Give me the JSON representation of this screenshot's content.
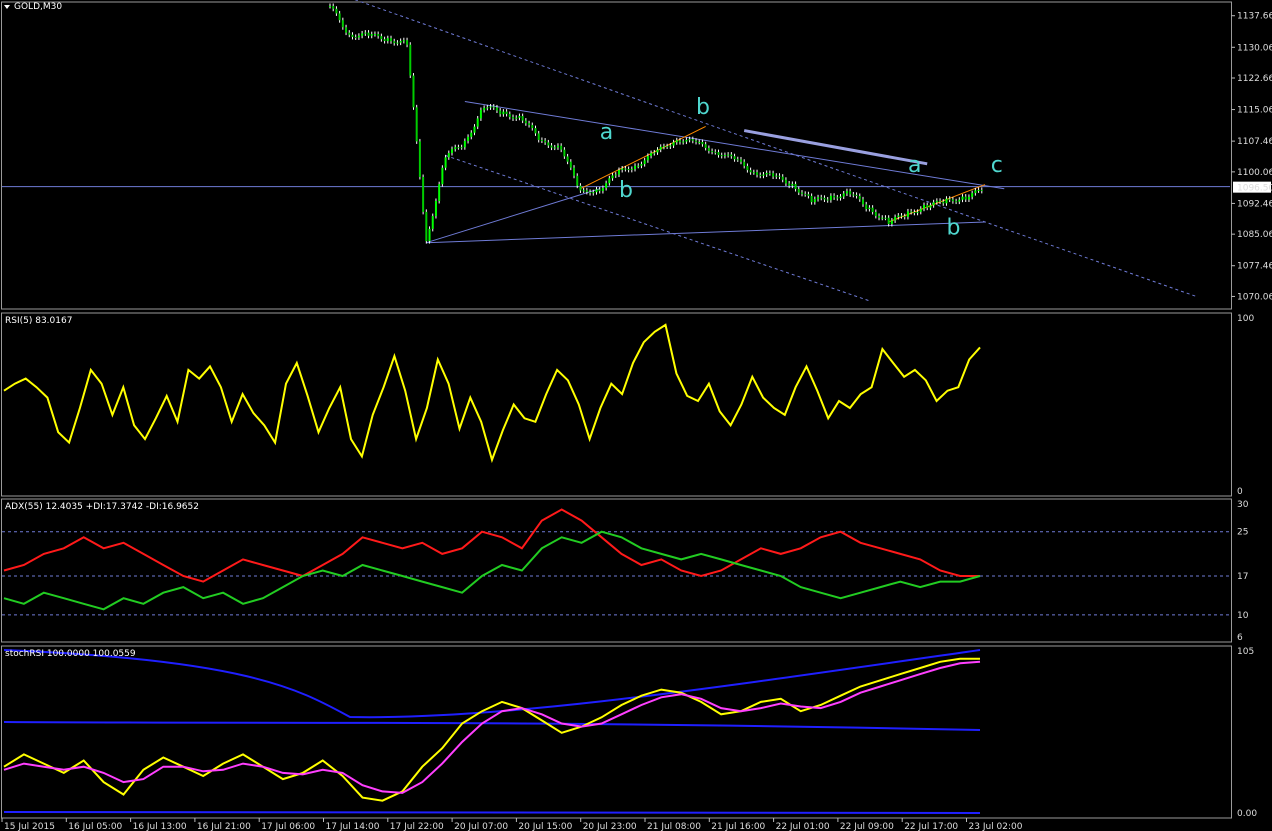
{
  "window": {
    "title": "GOLD,M30"
  },
  "colors": {
    "background": "#000000",
    "grid_border": "#9a9a9a",
    "trendline": "#6f7bd6",
    "rsi": "#ffff00",
    "adx_plus": "#ff1a1a",
    "adx_minus": "#22cc22",
    "stoch_main": "#ffff00",
    "stoch_signal": "#ff3fff",
    "stoch_band": "#1f1fff",
    "wave_label": "#4fd7cf"
  },
  "chart_data": [
    {
      "type": "candlestick",
      "panel": "price",
      "title": "GOLD,M30",
      "yticks": [
        "1137.66",
        "1130.06",
        "1122.66",
        "1115.06",
        "1107.46",
        "1100.06",
        "1092.46",
        "1085.06",
        "1077.46",
        "1070.06"
      ],
      "current_price": "1096.50",
      "wave_labels": [
        "a",
        "b",
        "b",
        "a",
        "c",
        "b"
      ],
      "series": [
        {
          "name": "close",
          "x": [
            0,
            10,
            20,
            30,
            40,
            50,
            60,
            70,
            80,
            90,
            100,
            110,
            120,
            130,
            140,
            150,
            160,
            170,
            180,
            190,
            200,
            210,
            220,
            230,
            240,
            250,
            260,
            270,
            280,
            290,
            300,
            310,
            320,
            330,
            340
          ],
          "values": [
            1140,
            1133,
            1133,
            1132,
            1131,
            1083,
            1104,
            1107,
            1116,
            1114,
            1113,
            1107,
            1106,
            1095,
            1096,
            1100,
            1102,
            1105,
            1108,
            1107,
            1105,
            1103,
            1100,
            1099,
            1097,
            1093,
            1094,
            1095,
            1091,
            1088,
            1090,
            1092,
            1093,
            1094,
            1096
          ]
        }
      ]
    },
    {
      "type": "line",
      "panel": "rsi",
      "title": "RSI(5) 83.0167",
      "yticks": [
        "100",
        "0"
      ],
      "ylim": [
        0,
        100
      ],
      "series": [
        {
          "name": "RSI(5)",
          "values": [
            58,
            62,
            65,
            60,
            54,
            34,
            28,
            48,
            70,
            62,
            44,
            60,
            38,
            30,
            42,
            55,
            40,
            70,
            65,
            72,
            60,
            40,
            56,
            45,
            38,
            28,
            62,
            74,
            55,
            34,
            48,
            60,
            30,
            20,
            44,
            60,
            78,
            58,
            30,
            48,
            76,
            62,
            36,
            54,
            40,
            18,
            35,
            50,
            42,
            40,
            56,
            70,
            64,
            50,
            30,
            48,
            62,
            56,
            74,
            86,
            92,
            96,
            68,
            55,
            52,
            62,
            46,
            38,
            50,
            66,
            54,
            48,
            44,
            60,
            72,
            58,
            42,
            52,
            48,
            56,
            60,
            82,
            74,
            66,
            70,
            64,
            52,
            58,
            60,
            76,
            83
          ]
        }
      ]
    },
    {
      "type": "line",
      "panel": "adx",
      "title": "ADX(55) 12.4035 +DI:17.3742 -DI:16.9652",
      "yticks": [
        "30",
        "25",
        "17",
        "10",
        "6"
      ],
      "ylim": [
        6,
        30
      ],
      "series": [
        {
          "name": "+DI",
          "values": [
            18,
            19,
            21,
            22,
            24,
            22,
            23,
            21,
            19,
            17,
            16,
            18,
            20,
            19,
            18,
            17,
            19,
            21,
            24,
            23,
            22,
            23,
            21,
            22,
            25,
            24,
            22,
            27,
            29,
            27,
            24,
            21,
            19,
            20,
            18,
            17,
            18,
            20,
            22,
            21,
            22,
            24,
            25,
            23,
            22,
            21,
            20,
            18,
            17,
            17
          ]
        },
        {
          "name": "-DI",
          "values": [
            13,
            12,
            14,
            13,
            12,
            11,
            13,
            12,
            14,
            15,
            13,
            14,
            12,
            13,
            15,
            17,
            18,
            17,
            19,
            18,
            17,
            16,
            15,
            14,
            17,
            19,
            18,
            22,
            24,
            23,
            25,
            24,
            22,
            21,
            20,
            21,
            20,
            19,
            18,
            17,
            15,
            14,
            13,
            14,
            15,
            16,
            15,
            16,
            16,
            17
          ]
        }
      ]
    },
    {
      "type": "line",
      "panel": "stochrsi",
      "title": "stochRSI 100.0000 100.0559",
      "yticks": [
        "105",
        "0.00"
      ],
      "ylim": [
        0,
        105
      ],
      "x_tick_labels": [
        "15 Jul 2015",
        "16 Jul 05:00",
        "16 Jul 13:00",
        "16 Jul 21:00",
        "17 Jul 06:00",
        "17 Jul 14:00",
        "17 Jul 22:00",
        "20 Jul 07:00",
        "20 Jul 15:00",
        "20 Jul 23:00",
        "21 Jul 08:00",
        "21 Jul 16:00",
        "22 Jul 01:00",
        "22 Jul 09:00",
        "22 Jul 17:00",
        "23 Jul 02:00"
      ],
      "series": [
        {
          "name": "stochRSI",
          "values": [
            30,
            38,
            32,
            26,
            34,
            20,
            12,
            28,
            36,
            30,
            24,
            32,
            38,
            30,
            22,
            26,
            34,
            24,
            10,
            8,
            14,
            30,
            42,
            58,
            66,
            72,
            68,
            60,
            52,
            56,
            62,
            70,
            76,
            80,
            78,
            72,
            64,
            66,
            72,
            74,
            66,
            70,
            76,
            82,
            86,
            90,
            94,
            98,
            100,
            100
          ]
        },
        {
          "name": "signal",
          "values": [
            28,
            32,
            30,
            28,
            30,
            26,
            20,
            22,
            30,
            30,
            27,
            28,
            32,
            30,
            26,
            25,
            28,
            26,
            18,
            14,
            13,
            20,
            32,
            46,
            58,
            66,
            68,
            64,
            58,
            56,
            58,
            64,
            70,
            75,
            77,
            74,
            68,
            66,
            68,
            71,
            69,
            68,
            72,
            78,
            82,
            86,
            90,
            94,
            97,
            98
          ]
        }
      ]
    }
  ]
}
